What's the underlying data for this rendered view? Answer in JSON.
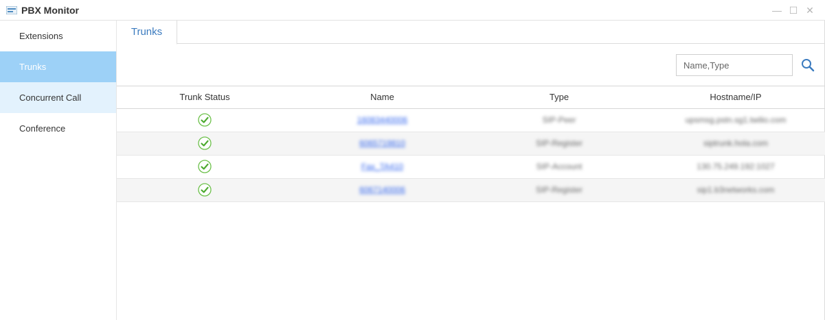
{
  "window": {
    "title": "PBX Monitor",
    "minimize_glyph": "—",
    "maximize_glyph": "☐",
    "close_glyph": "✕"
  },
  "sidebar": {
    "items": [
      {
        "label": "Extensions",
        "state": "normal"
      },
      {
        "label": "Trunks",
        "state": "active"
      },
      {
        "label": "Concurrent Call",
        "state": "hover"
      },
      {
        "label": "Conference",
        "state": "normal"
      }
    ]
  },
  "tabs": [
    {
      "label": "Trunks",
      "active": true
    }
  ],
  "search": {
    "placeholder": "Name,Type",
    "value": "",
    "icon": "search-icon"
  },
  "table": {
    "headers": [
      "Trunk Status",
      "Name",
      "Type",
      "Hostname/IP"
    ],
    "rows": [
      {
        "status": "ok",
        "name": "16083440006",
        "type": "SIP-Peer",
        "host": "upsmsg.pstn.sg1.twilio.com"
      },
      {
        "status": "ok",
        "name": "6065719810",
        "type": "SIP-Register",
        "host": "siptrunk.hola.com"
      },
      {
        "status": "ok",
        "name": "Fax_TA410",
        "type": "SIP-Account",
        "host": "130.75.249.192:1027"
      },
      {
        "status": "ok",
        "name": "6067140006",
        "type": "SIP-Register",
        "host": "sip1.b3networks.com"
      }
    ]
  },
  "colors": {
    "accent": "#3b7bbf",
    "sidebar_active": "#9dd1f7",
    "sidebar_hover": "#e3f2fd",
    "status_ok": "#6cc04a",
    "link": "#3366ee"
  }
}
